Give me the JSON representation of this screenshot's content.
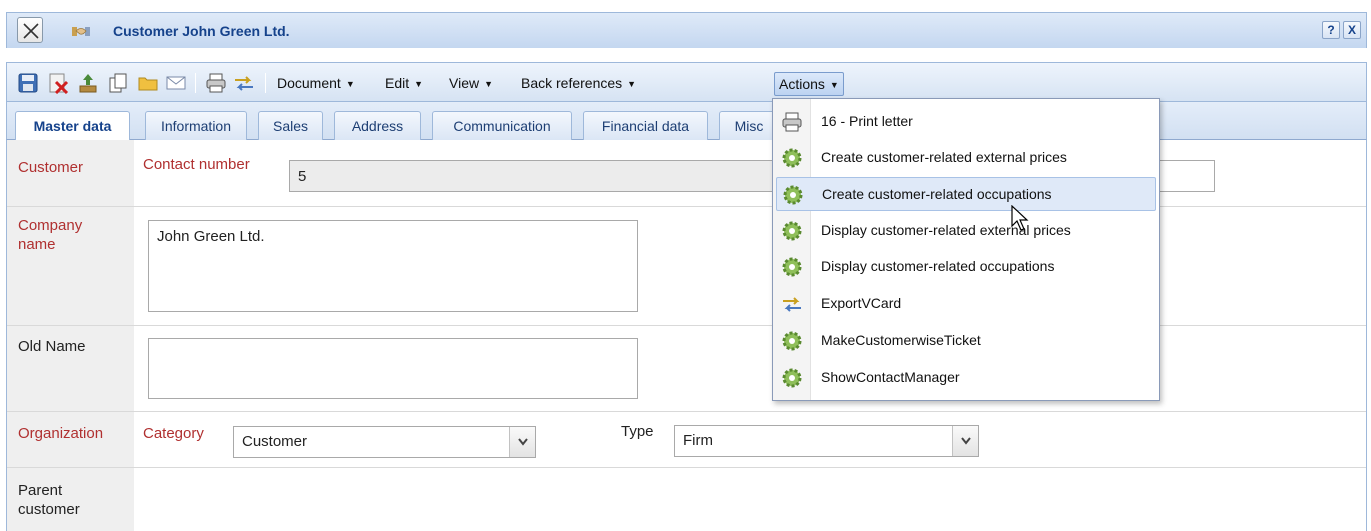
{
  "window": {
    "title": "Customer John Green Ltd.",
    "help_label": "?",
    "close_label": "X"
  },
  "toolbar": {
    "icons": [
      "save-icon",
      "delete-icon",
      "upload-icon",
      "copy-icon",
      "folder-icon",
      "mail-icon",
      "print-icon",
      "exchange-icon"
    ],
    "menus": [
      {
        "label": "Document"
      },
      {
        "label": "Edit"
      },
      {
        "label": "View"
      },
      {
        "label": "Back references"
      },
      {
        "label": "Actions"
      }
    ]
  },
  "tabs": [
    "Master data",
    "Information",
    "Sales",
    "Address",
    "Communication",
    "Financial data",
    "Misc"
  ],
  "form": {
    "customer": {
      "label": "Customer",
      "contact_number_label": "Contact number",
      "contact_number_value": "5"
    },
    "company": {
      "label": "Company name",
      "value": "John Green Ltd."
    },
    "old_name": {
      "label": "Old Name",
      "value": ""
    },
    "organization": {
      "label": "Organization",
      "category_label": "Category",
      "category_value": "Customer",
      "type_label": "Type",
      "type_value": "Firm"
    },
    "parent": {
      "label": "Parent customer"
    }
  },
  "actions_menu": {
    "items": [
      {
        "label": "16 - Print letter",
        "icon": "print-icon"
      },
      {
        "label": "Create customer-related external prices",
        "icon": "gear-icon"
      },
      {
        "label": "Create customer-related occupations",
        "icon": "gear-icon"
      },
      {
        "label": "Display customer-related external prices",
        "icon": "gear-icon"
      },
      {
        "label": "Display customer-related occupations",
        "icon": "gear-icon"
      },
      {
        "label": "ExportVCard",
        "icon": "exchange-icon"
      },
      {
        "label": "MakeCustomerwiseTicket",
        "icon": "gear-icon"
      },
      {
        "label": "ShowContactManager",
        "icon": "gear-icon"
      }
    ],
    "highlighted_index": 2
  },
  "colors": {
    "required_label": "#b03030",
    "title_text": "#15428b",
    "highlight": "#dfe9f8"
  }
}
